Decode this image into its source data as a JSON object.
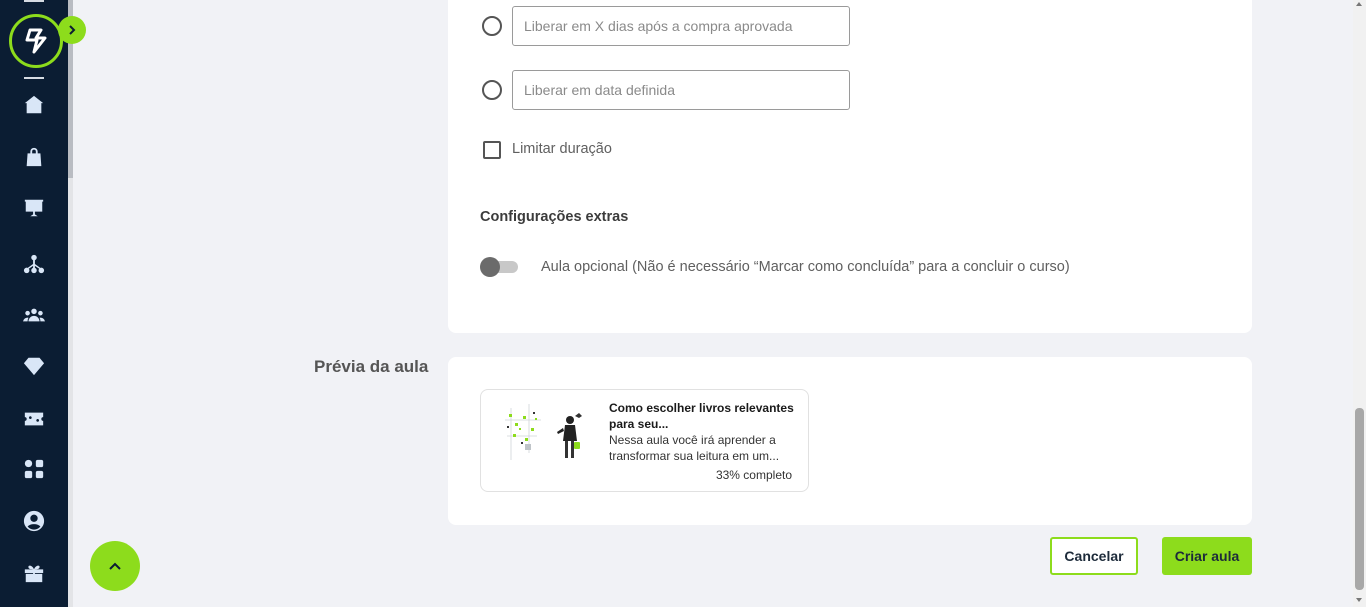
{
  "release": {
    "days_placeholder": "Liberar em X dias após a compra aprovada",
    "date_placeholder": "Liberar em data definida",
    "limit_label": "Limitar duração"
  },
  "extras": {
    "title": "Configurações extras",
    "optional_label": "Aula opcional (Não é necessário “Marcar como concluída” para a concluir o curso)"
  },
  "preview": {
    "section_label": "Prévia da aula",
    "card_title": "Como escolher livros relevantes para seu...",
    "card_desc": "Nessa aula você irá aprender a transformar sua leitura em um...",
    "progress": "33% completo"
  },
  "actions": {
    "cancel": "Cancelar",
    "create": "Criar aula"
  },
  "colors": {
    "accent": "#8ddc1c",
    "sidebar": "#0b1d33",
    "background": "#f1f2f6"
  },
  "sidebar": {
    "icons": [
      "home-icon",
      "shopping-bag-icon",
      "presentation-chart-icon",
      "network-icon",
      "users-icon",
      "diamond-icon",
      "ticket-icon",
      "apps-grid-icon",
      "account-circle-icon",
      "gift-icon"
    ]
  }
}
